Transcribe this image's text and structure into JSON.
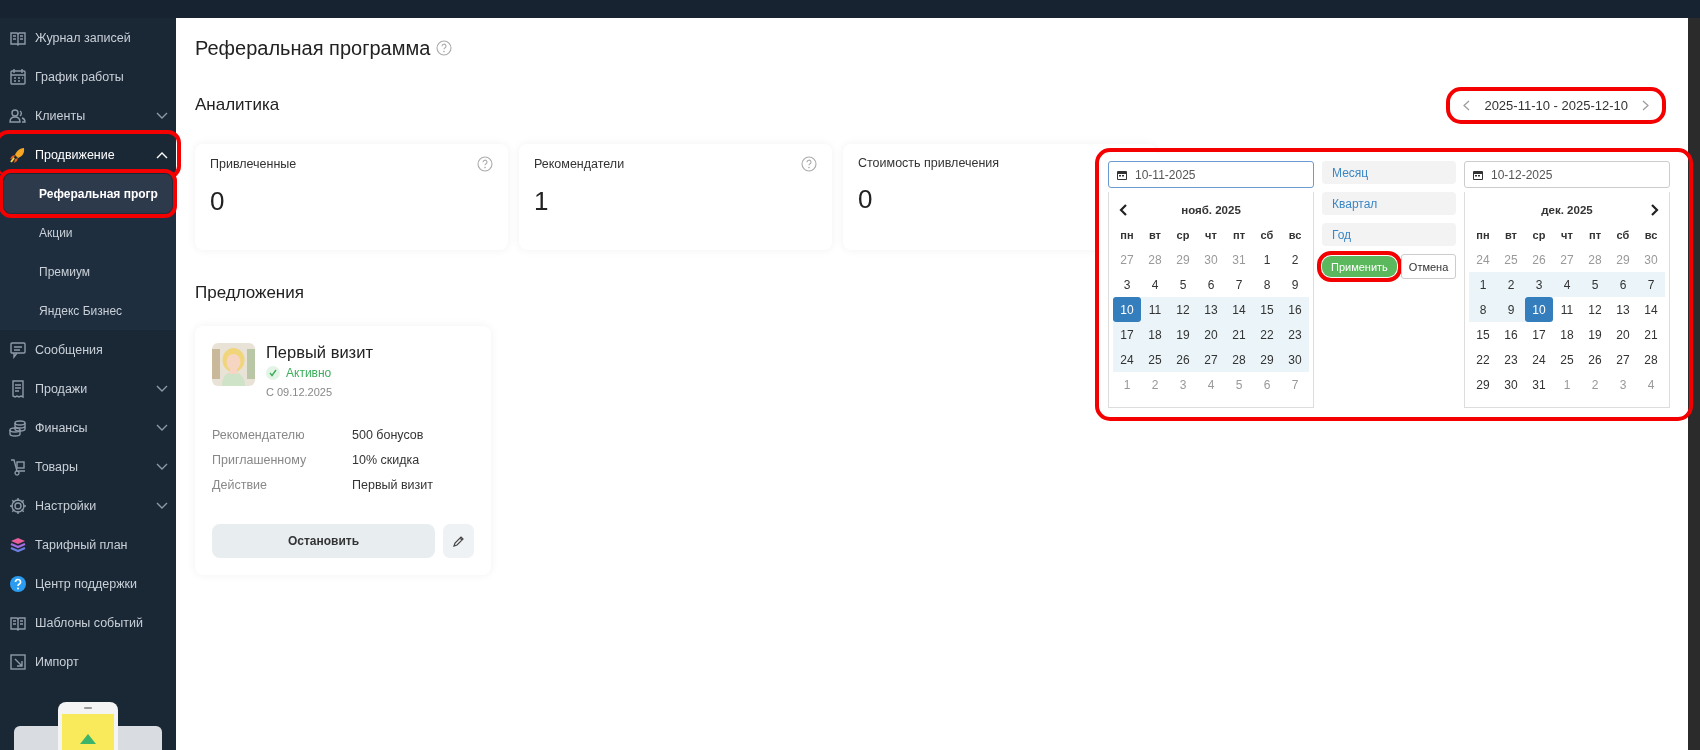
{
  "sidebar": {
    "items": [
      {
        "label": "Журнал записей",
        "kind": "link",
        "highlighted": false
      },
      {
        "label": "График работы",
        "kind": "link",
        "highlighted": false
      },
      {
        "label": "Клиенты",
        "kind": "group",
        "expanded": false,
        "highlighted": false
      },
      {
        "label": "Продвижение",
        "kind": "group",
        "expanded": true,
        "highlighted": true,
        "children": [
          {
            "label": "Реферальная прогр",
            "selected": true,
            "highlighted": true
          },
          {
            "label": "Акции",
            "selected": false,
            "highlighted": false
          },
          {
            "label": "Премиум",
            "selected": false,
            "highlighted": false
          },
          {
            "label": "Яндекс Бизнес",
            "selected": false,
            "highlighted": false
          }
        ]
      },
      {
        "label": "Сообщения",
        "kind": "link",
        "highlighted": false
      },
      {
        "label": "Продажи",
        "kind": "group",
        "expanded": false,
        "highlighted": false
      },
      {
        "label": "Финансы",
        "kind": "group",
        "expanded": false,
        "highlighted": false
      },
      {
        "label": "Товары",
        "kind": "group",
        "expanded": false,
        "highlighted": false
      },
      {
        "label": "Настройки",
        "kind": "group",
        "expanded": false,
        "highlighted": false
      },
      {
        "label": "Тарифный план",
        "kind": "link",
        "highlighted": false
      },
      {
        "label": "Центр поддержки",
        "kind": "link",
        "highlighted": false
      },
      {
        "label": "Шаблоны событий",
        "kind": "link",
        "highlighted": false
      },
      {
        "label": "Импорт",
        "kind": "link",
        "highlighted": false
      }
    ]
  },
  "page": {
    "title": "Реферальная программа"
  },
  "analytics": {
    "heading": "Аналитика",
    "date_range": {
      "label": "2025-11-10 - 2025-12-10",
      "highlighted": true
    },
    "stats": [
      {
        "label": "Привлеченные",
        "value": "0",
        "help": true
      },
      {
        "label": "Рекомендатели",
        "value": "1",
        "help": true
      },
      {
        "label": "Стоимость привлечения",
        "value": "0",
        "help": false
      }
    ]
  },
  "offers": {
    "heading": "Предложения",
    "cards": [
      {
        "kind": "picture",
        "title": "Первый визит",
        "status": "Активно",
        "active": true,
        "since": "С 09.12.2025",
        "details": [
          {
            "label": "Рекомендателю",
            "value": "500 бонусов"
          },
          {
            "label": "Приглашенному",
            "value": "10% скидка"
          },
          {
            "label": "Действие",
            "value": "Первый визит"
          }
        ],
        "button": "Остановить"
      }
    ]
  },
  "date_picker": {
    "highlighted": true,
    "start": {
      "value": "10-11-2025",
      "focused": true,
      "month": "нояб. 2025",
      "prev_arrow": true,
      "next_arrow": false,
      "weekdays": [
        "пн",
        "вт",
        "ср",
        "чт",
        "пт",
        "сб",
        "вс"
      ],
      "weeks": [
        [
          {
            "t": "27",
            "muted": true,
            "in_range": false,
            "selected": false
          },
          {
            "t": "28",
            "muted": true,
            "in_range": false,
            "selected": false
          },
          {
            "t": "29",
            "muted": true,
            "in_range": false,
            "selected": false
          },
          {
            "t": "30",
            "muted": true,
            "in_range": false,
            "selected": false
          },
          {
            "t": "31",
            "muted": true,
            "in_range": false,
            "selected": false
          },
          {
            "t": "1",
            "muted": false,
            "in_range": false,
            "selected": false
          },
          {
            "t": "2",
            "muted": false,
            "in_range": false,
            "selected": false
          }
        ],
        [
          {
            "t": "3",
            "muted": false,
            "in_range": false,
            "selected": false
          },
          {
            "t": "4",
            "muted": false,
            "in_range": false,
            "selected": false
          },
          {
            "t": "5",
            "muted": false,
            "in_range": false,
            "selected": false
          },
          {
            "t": "6",
            "muted": false,
            "in_range": false,
            "selected": false
          },
          {
            "t": "7",
            "muted": false,
            "in_range": false,
            "selected": false
          },
          {
            "t": "8",
            "muted": false,
            "in_range": false,
            "selected": false
          },
          {
            "t": "9",
            "muted": false,
            "in_range": false,
            "selected": false
          }
        ],
        [
          {
            "t": "10",
            "muted": false,
            "in_range": true,
            "selected": true
          },
          {
            "t": "11",
            "muted": false,
            "in_range": true,
            "selected": false
          },
          {
            "t": "12",
            "muted": false,
            "in_range": true,
            "selected": false
          },
          {
            "t": "13",
            "muted": false,
            "in_range": true,
            "selected": false
          },
          {
            "t": "14",
            "muted": false,
            "in_range": true,
            "selected": false
          },
          {
            "t": "15",
            "muted": false,
            "in_range": true,
            "selected": false
          },
          {
            "t": "16",
            "muted": false,
            "in_range": true,
            "selected": false
          }
        ],
        [
          {
            "t": "17",
            "muted": false,
            "in_range": true,
            "selected": false
          },
          {
            "t": "18",
            "muted": false,
            "in_range": true,
            "selected": false
          },
          {
            "t": "19",
            "muted": false,
            "in_range": true,
            "selected": false
          },
          {
            "t": "20",
            "muted": false,
            "in_range": true,
            "selected": false
          },
          {
            "t": "21",
            "muted": false,
            "in_range": true,
            "selected": false
          },
          {
            "t": "22",
            "muted": false,
            "in_range": true,
            "selected": false
          },
          {
            "t": "23",
            "muted": false,
            "in_range": true,
            "selected": false
          }
        ],
        [
          {
            "t": "24",
            "muted": false,
            "in_range": true,
            "selected": false
          },
          {
            "t": "25",
            "muted": false,
            "in_range": true,
            "selected": false
          },
          {
            "t": "26",
            "muted": false,
            "in_range": true,
            "selected": false
          },
          {
            "t": "27",
            "muted": false,
            "in_range": true,
            "selected": false
          },
          {
            "t": "28",
            "muted": false,
            "in_range": true,
            "selected": false
          },
          {
            "t": "29",
            "muted": false,
            "in_range": true,
            "selected": false
          },
          {
            "t": "30",
            "muted": false,
            "in_range": true,
            "selected": false
          }
        ],
        [
          {
            "t": "1",
            "muted": true,
            "in_range": false,
            "selected": false
          },
          {
            "t": "2",
            "muted": true,
            "in_range": false,
            "selected": false
          },
          {
            "t": "3",
            "muted": true,
            "in_range": false,
            "selected": false
          },
          {
            "t": "4",
            "muted": true,
            "in_range": false,
            "selected": false
          },
          {
            "t": "5",
            "muted": true,
            "in_range": false,
            "selected": false
          },
          {
            "t": "6",
            "muted": true,
            "in_range": false,
            "selected": false
          },
          {
            "t": "7",
            "muted": true,
            "in_range": false,
            "selected": false
          }
        ]
      ]
    },
    "ranges": [
      "Месяц",
      "Квартал",
      "Год"
    ],
    "apply": {
      "label": "Применить",
      "highlighted": true
    },
    "cancel": "Отмена",
    "end": {
      "value": "10-12-2025",
      "focused": false,
      "month": "дек. 2025",
      "prev_arrow": false,
      "next_arrow": true,
      "weekdays": [
        "пн",
        "вт",
        "ср",
        "чт",
        "пт",
        "сб",
        "вс"
      ],
      "weeks": [
        [
          {
            "t": "24",
            "muted": true,
            "in_range": false,
            "selected": false
          },
          {
            "t": "25",
            "muted": true,
            "in_range": false,
            "selected": false
          },
          {
            "t": "26",
            "muted": true,
            "in_range": false,
            "selected": false
          },
          {
            "t": "27",
            "muted": true,
            "in_range": false,
            "selected": false
          },
          {
            "t": "28",
            "muted": true,
            "in_range": false,
            "selected": false
          },
          {
            "t": "29",
            "muted": true,
            "in_range": false,
            "selected": false
          },
          {
            "t": "30",
            "muted": true,
            "in_range": false,
            "selected": false
          }
        ],
        [
          {
            "t": "1",
            "muted": false,
            "in_range": true,
            "selected": false
          },
          {
            "t": "2",
            "muted": false,
            "in_range": true,
            "selected": false
          },
          {
            "t": "3",
            "muted": false,
            "in_range": true,
            "selected": false
          },
          {
            "t": "4",
            "muted": false,
            "in_range": true,
            "selected": false
          },
          {
            "t": "5",
            "muted": false,
            "in_range": true,
            "selected": false
          },
          {
            "t": "6",
            "muted": false,
            "in_range": true,
            "selected": false
          },
          {
            "t": "7",
            "muted": false,
            "in_range": true,
            "selected": false
          }
        ],
        [
          {
            "t": "8",
            "muted": false,
            "in_range": true,
            "selected": false
          },
          {
            "t": "9",
            "muted": false,
            "in_range": true,
            "selected": false
          },
          {
            "t": "10",
            "muted": false,
            "in_range": true,
            "selected": true
          },
          {
            "t": "11",
            "muted": false,
            "in_range": false,
            "selected": false
          },
          {
            "t": "12",
            "muted": false,
            "in_range": false,
            "selected": false
          },
          {
            "t": "13",
            "muted": false,
            "in_range": false,
            "selected": false
          },
          {
            "t": "14",
            "muted": false,
            "in_range": false,
            "selected": false
          }
        ],
        [
          {
            "t": "15",
            "muted": false,
            "in_range": false,
            "selected": false
          },
          {
            "t": "16",
            "muted": false,
            "in_range": false,
            "selected": false
          },
          {
            "t": "17",
            "muted": false,
            "in_range": false,
            "selected": false
          },
          {
            "t": "18",
            "muted": false,
            "in_range": false,
            "selected": false
          },
          {
            "t": "19",
            "muted": false,
            "in_range": false,
            "selected": false
          },
          {
            "t": "20",
            "muted": false,
            "in_range": false,
            "selected": false
          },
          {
            "t": "21",
            "muted": false,
            "in_range": false,
            "selected": false
          }
        ],
        [
          {
            "t": "22",
            "muted": false,
            "in_range": false,
            "selected": false
          },
          {
            "t": "23",
            "muted": false,
            "in_range": false,
            "selected": false
          },
          {
            "t": "24",
            "muted": false,
            "in_range": false,
            "selected": false
          },
          {
            "t": "25",
            "muted": false,
            "in_range": false,
            "selected": false
          },
          {
            "t": "26",
            "muted": false,
            "in_range": false,
            "selected": false
          },
          {
            "t": "27",
            "muted": false,
            "in_range": false,
            "selected": false
          },
          {
            "t": "28",
            "muted": false,
            "in_range": false,
            "selected": false
          }
        ],
        [
          {
            "t": "29",
            "muted": false,
            "in_range": false,
            "selected": false
          },
          {
            "t": "30",
            "muted": false,
            "in_range": false,
            "selected": false
          },
          {
            "t": "31",
            "muted": false,
            "in_range": false,
            "selected": false
          },
          {
            "t": "1",
            "muted": true,
            "in_range": false,
            "selected": false
          },
          {
            "t": "2",
            "muted": true,
            "in_range": false,
            "selected": false
          },
          {
            "t": "3",
            "muted": true,
            "in_range": false,
            "selected": false
          },
          {
            "t": "4",
            "muted": true,
            "in_range": false,
            "selected": false
          }
        ]
      ]
    }
  }
}
